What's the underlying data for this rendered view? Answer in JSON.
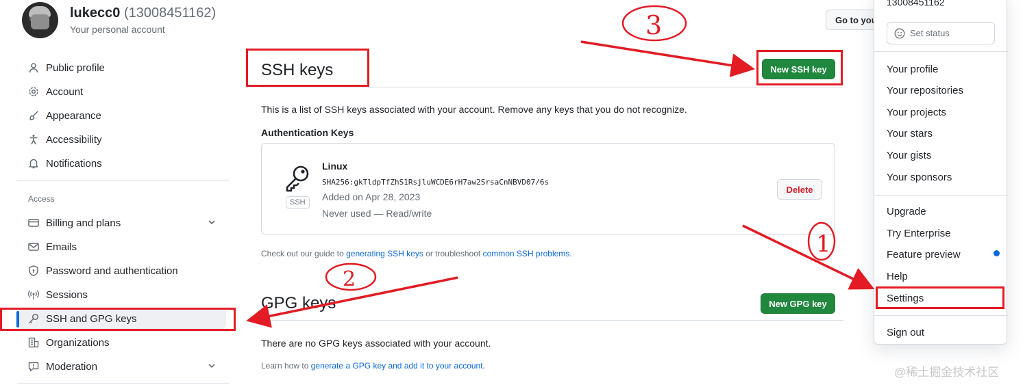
{
  "account": {
    "username": "lukecc0",
    "number": "(13008451162)",
    "subtitle": "Your personal account",
    "goto_label": "Go to you"
  },
  "sidebar": {
    "items": [
      {
        "label": "Public profile",
        "icon": "person-icon"
      },
      {
        "label": "Account",
        "icon": "gear-icon"
      },
      {
        "label": "Appearance",
        "icon": "paintbrush-icon"
      },
      {
        "label": "Accessibility",
        "icon": "accessibility-icon"
      },
      {
        "label": "Notifications",
        "icon": "bell-icon"
      }
    ],
    "access_label": "Access",
    "access_items": [
      {
        "label": "Billing and plans",
        "icon": "credit-card-icon",
        "expandable": true
      },
      {
        "label": "Emails",
        "icon": "mail-icon"
      },
      {
        "label": "Password and authentication",
        "icon": "shield-lock-icon"
      },
      {
        "label": "Sessions",
        "icon": "broadcast-icon"
      },
      {
        "label": "SSH and GPG keys",
        "icon": "key-icon",
        "active": true
      },
      {
        "label": "Organizations",
        "icon": "organization-icon"
      },
      {
        "label": "Moderation",
        "icon": "report-icon",
        "expandable": true
      }
    ]
  },
  "ssh": {
    "title": "SSH keys",
    "new_button": "New SSH key",
    "description": "This is a list of SSH keys associated with your account. Remove any keys that you do not recognize.",
    "auth_heading": "Authentication Keys",
    "key": {
      "name": "Linux",
      "fingerprint": "SHA256:gkTldpTfZhS1RsjluWCDE6rH7aw2SrsaCnNBVD07/6s",
      "added": "Added on Apr 28, 2023",
      "usage": "Never used — Read/write",
      "badge": "SSH",
      "delete_label": "Delete"
    },
    "guide_prefix": "Check out our guide to",
    "guide_link1": "generating SSH keys",
    "guide_mid": "or troubleshoot",
    "guide_link2": "common SSH problems."
  },
  "gpg": {
    "title": "GPG keys",
    "new_button": "New GPG key",
    "empty_text": "There are no GPG keys associated with your account.",
    "learn_prefix": "Learn how to",
    "learn_link": "generate a GPG key and add it to your account."
  },
  "dropdown": {
    "top_text": "13008451162",
    "set_status": "Set status",
    "group1": [
      "Your profile",
      "Your repositories",
      "Your projects",
      "Your stars",
      "Your gists",
      "Your sponsors"
    ],
    "group2": [
      "Upgrade",
      "Try Enterprise",
      "Feature preview",
      "Help",
      "Settings"
    ],
    "sign_out": "Sign out"
  },
  "annotations": {
    "step1": "1",
    "step2": "2",
    "step3": "3",
    "color": "#e21b24"
  },
  "watermark": "@稀土掘金技术社区",
  "colors": {
    "primary_green": "#1f883d",
    "link_blue": "#0969da",
    "danger_red": "#cf222e",
    "annotation_red": "#e21b24"
  }
}
